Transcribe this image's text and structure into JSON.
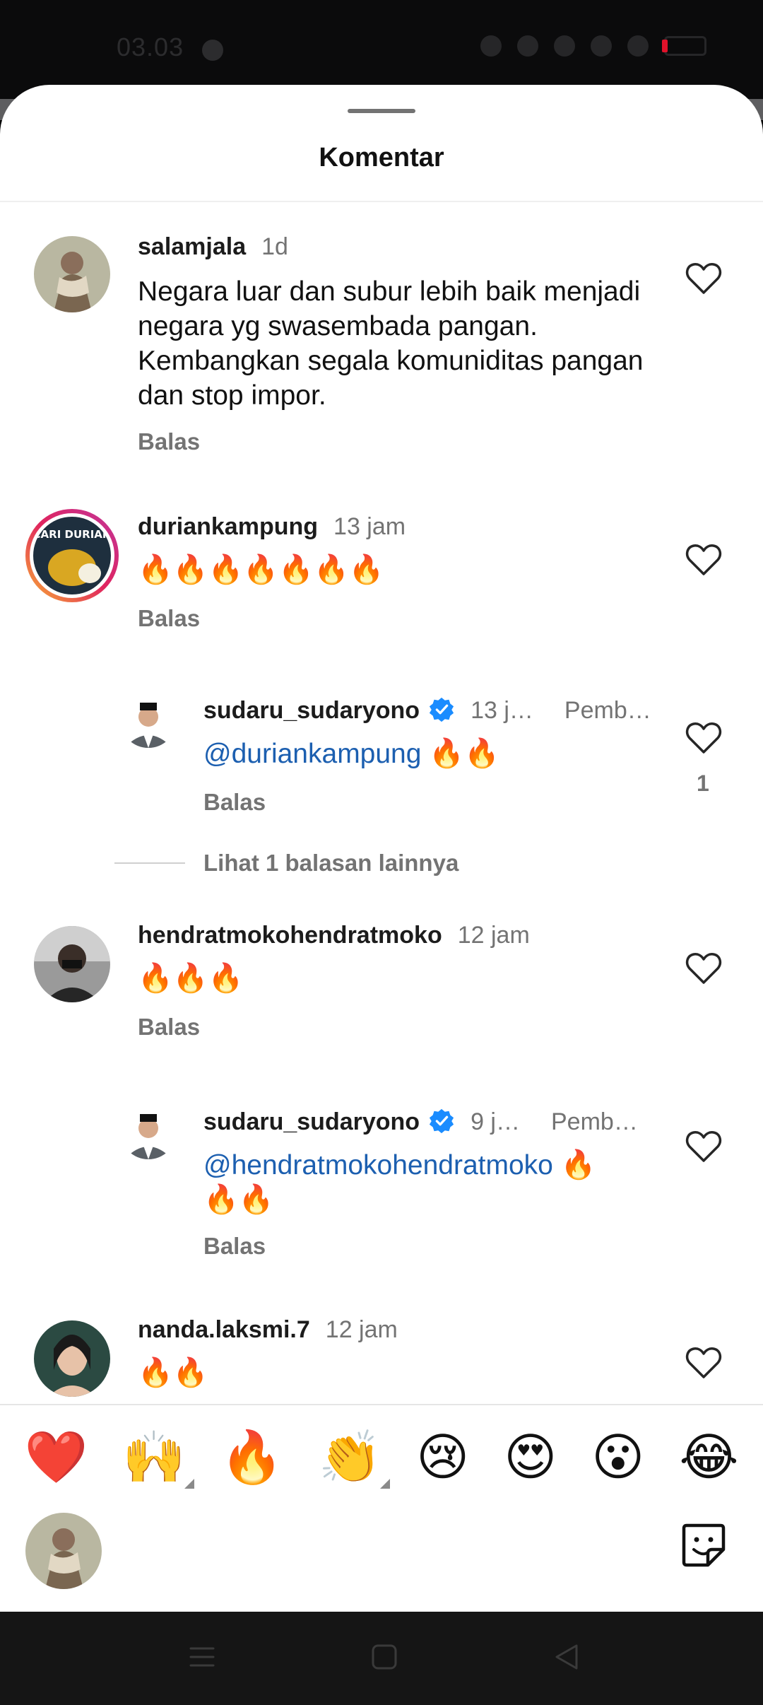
{
  "status_bar": {
    "time": "03.03"
  },
  "sheet": {
    "title": "Komentar"
  },
  "comments": [
    {
      "username": "salamjala",
      "time": "1d",
      "text": "Negara luar dan subur lebih baik menjadi negara yg swasembada pangan. Kembangkan segala komuniditas pangan dan stop impor.",
      "reply_label": "Balas"
    },
    {
      "username": "duriankampung",
      "time": "13 jam",
      "avatar_text": "CARI DURIAN",
      "text": "🔥🔥🔥🔥🔥🔥🔥",
      "reply_label": "Balas"
    },
    {
      "username": "sudaru_sudaryono",
      "time": "13 j…",
      "pinned_label": "Pemb…",
      "mention": "@duriankampung",
      "text": "🔥🔥",
      "reply_label": "Balas",
      "like_count": "1"
    },
    {
      "username": "hendratmokohendratmoko",
      "time": "12 jam",
      "text": "🔥🔥🔥",
      "reply_label": "Balas"
    },
    {
      "username": "sudaru_sudaryono",
      "time": "9 j…",
      "pinned_label": "Pemb…",
      "mention": "@hendratmokohendratmoko",
      "text_line1": "🔥",
      "text_line2": "🔥🔥",
      "reply_label": "Balas"
    },
    {
      "username": "nanda.laksmi.7",
      "time": "12 jam",
      "text": "🔥🔥"
    }
  ],
  "more_replies": "Lihat 1 balasan lainnya",
  "emoji_bar": [
    "❤️",
    "🙌",
    "🔥",
    "👏",
    "😢",
    "😍",
    "😮",
    "😂"
  ],
  "icons": {
    "like": "heart-outline-icon",
    "verified": "verified-badge-icon",
    "sticker": "sticker-icon",
    "nav": [
      "menu-icon",
      "home-square-icon",
      "back-triangle-icon"
    ]
  },
  "colors": {
    "mention": "#1c5fb0",
    "verified": "#1a8cff",
    "story_ring_start": "#f9b233",
    "story_ring_end": "#c1359b"
  }
}
